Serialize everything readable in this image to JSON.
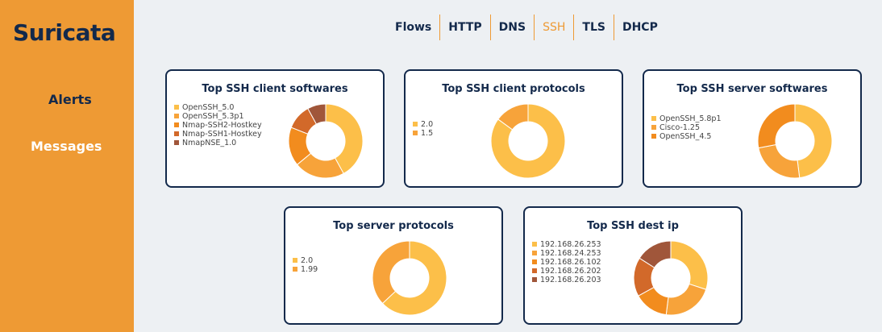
{
  "app": {
    "logo": "Suricata"
  },
  "sidebar": {
    "items": [
      {
        "label": "Alerts"
      },
      {
        "label": "Messages"
      }
    ]
  },
  "nav": {
    "tabs": [
      "Flows",
      "HTTP",
      "DNS",
      "SSH",
      "TLS",
      "DHCP"
    ],
    "active": "SSH"
  },
  "colors": {
    "sidebar": "#ee9a34",
    "navy": "#13294b",
    "background": "#edf0f3",
    "palette": [
      "#fcbf49",
      "#f7a33a",
      "#f28c1e",
      "#d2692a",
      "#a0563a"
    ]
  },
  "cards": [
    {
      "title": "Top SSH client softwares",
      "chart_data": {
        "type": "donut",
        "labels": [
          "OpenSSH_5.0",
          "OpenSSH_5.3p1",
          "Nmap-SSH2-Hostkey",
          "Nmap-SSH1-Hostkey",
          "NmapNSE_1.0"
        ],
        "values": [
          42,
          22,
          17,
          11,
          8
        ]
      }
    },
    {
      "title": "Top SSH client protocols",
      "chart_data": {
        "type": "donut",
        "labels": [
          "2.0",
          "1.5"
        ],
        "values": [
          85,
          15
        ]
      }
    },
    {
      "title": "Top SSH server softwares",
      "chart_data": {
        "type": "donut",
        "labels": [
          "OpenSSH_5.8p1",
          "Cisco-1.25",
          "OpenSSH_4.5"
        ],
        "values": [
          48,
          24,
          28
        ]
      }
    },
    {
      "title": "Top server protocols",
      "chart_data": {
        "type": "donut",
        "labels": [
          "2.0",
          "1.99"
        ],
        "values": [
          63,
          37
        ]
      }
    },
    {
      "title": "Top SSH dest ip",
      "chart_data": {
        "type": "donut",
        "labels": [
          "192.168.26.253",
          "192.168.24.253",
          "192.168.26.102",
          "192.168.26.202",
          "192.168.26.203"
        ],
        "values": [
          30,
          22,
          15,
          17,
          16
        ]
      }
    }
  ]
}
